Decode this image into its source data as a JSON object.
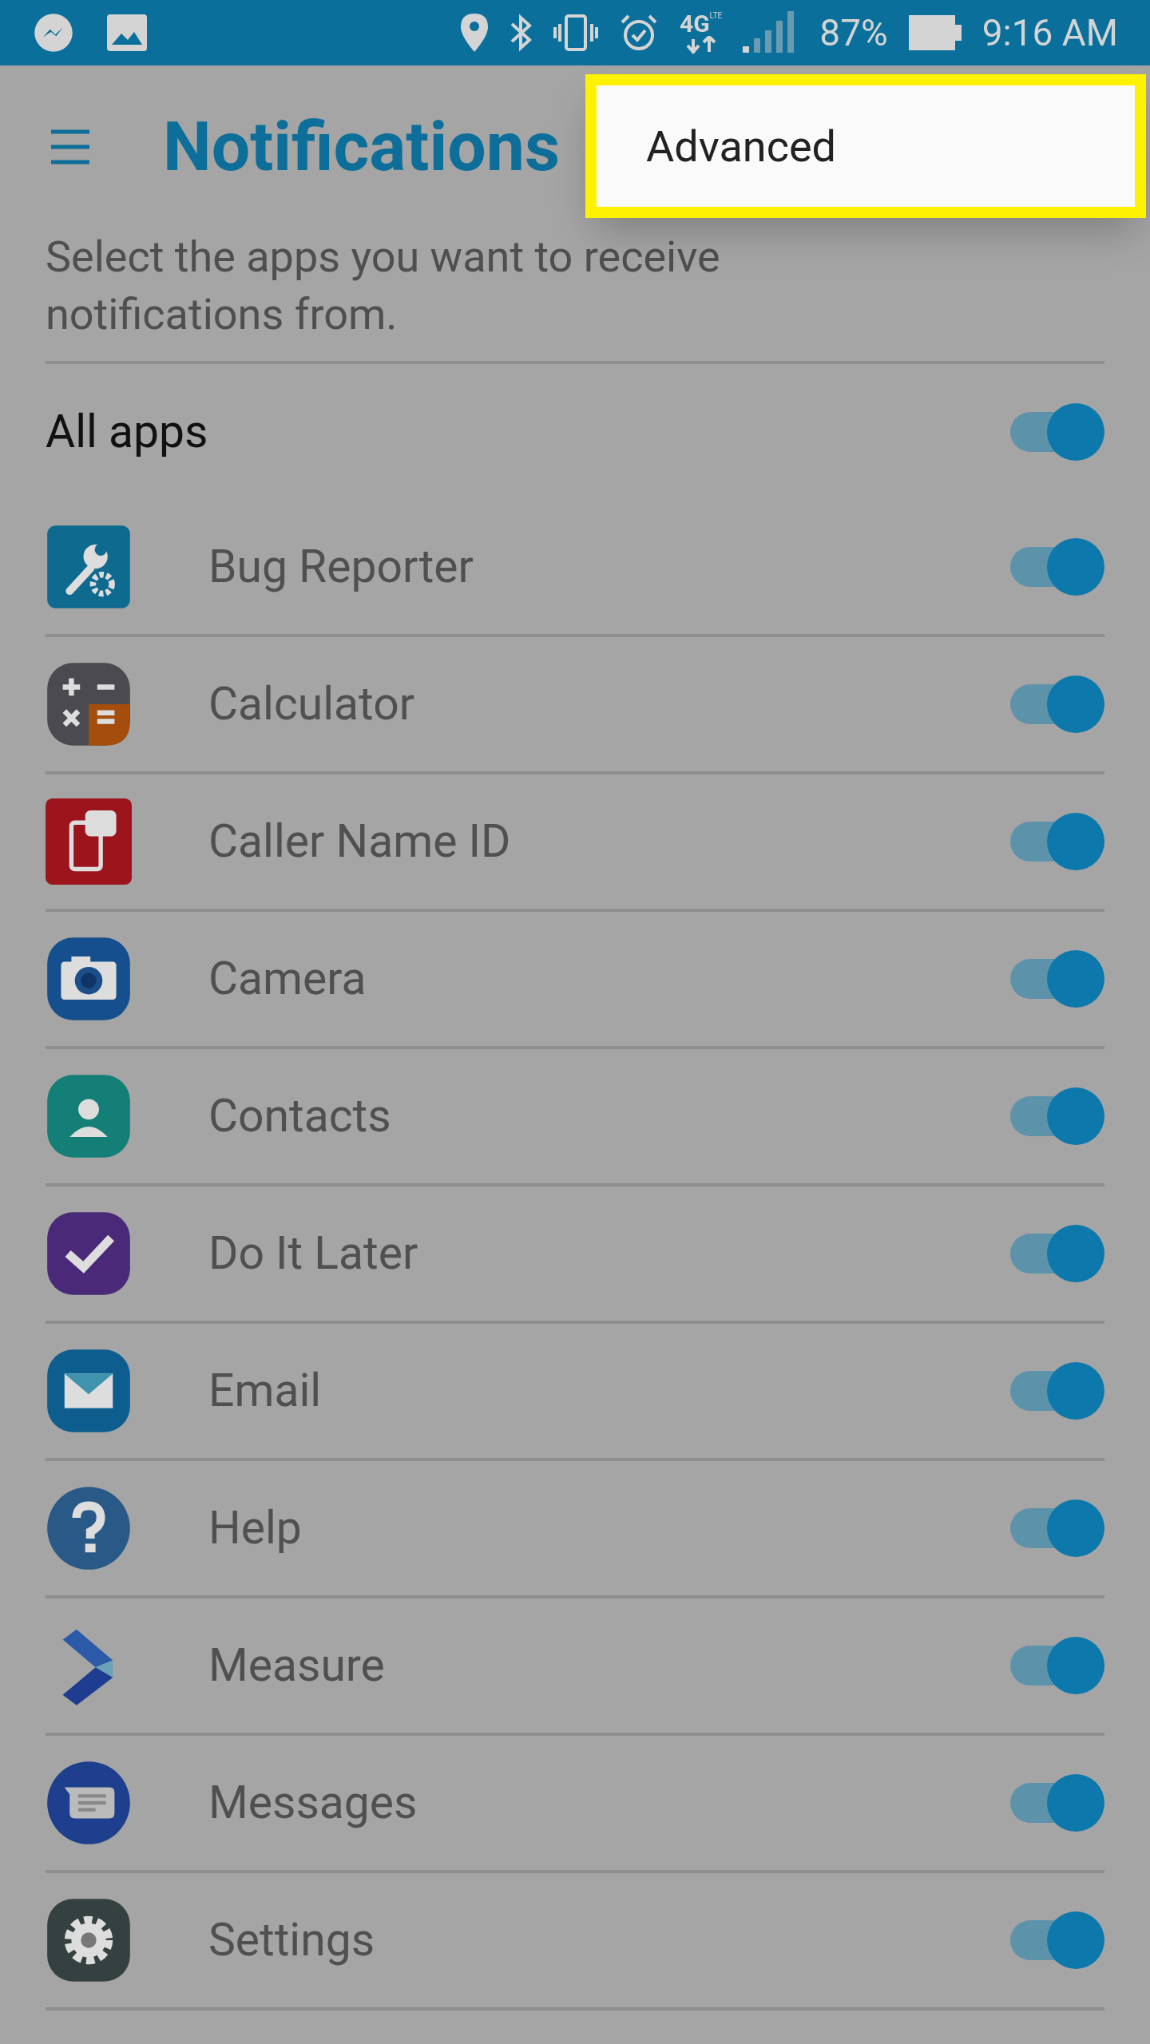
{
  "status_bar": {
    "network": "4G",
    "network_sub": "LTE",
    "battery": "87%",
    "time": "9:16 AM"
  },
  "header": {
    "title": "Notifications"
  },
  "menu": {
    "items": [
      "Advanced"
    ]
  },
  "description": "Select the apps you want to receive notifications from.",
  "all_apps": {
    "label": "All apps",
    "on": true
  },
  "apps": [
    {
      "name": "Bug Reporter",
      "on": true
    },
    {
      "name": "Calculator",
      "on": true
    },
    {
      "name": "Caller Name ID",
      "on": true
    },
    {
      "name": "Camera",
      "on": true
    },
    {
      "name": "Contacts",
      "on": true
    },
    {
      "name": "Do It Later",
      "on": true
    },
    {
      "name": "Email",
      "on": true
    },
    {
      "name": "Help",
      "on": true
    },
    {
      "name": "Measure",
      "on": true
    },
    {
      "name": "Messages",
      "on": true
    },
    {
      "name": "Settings",
      "on": true
    }
  ]
}
